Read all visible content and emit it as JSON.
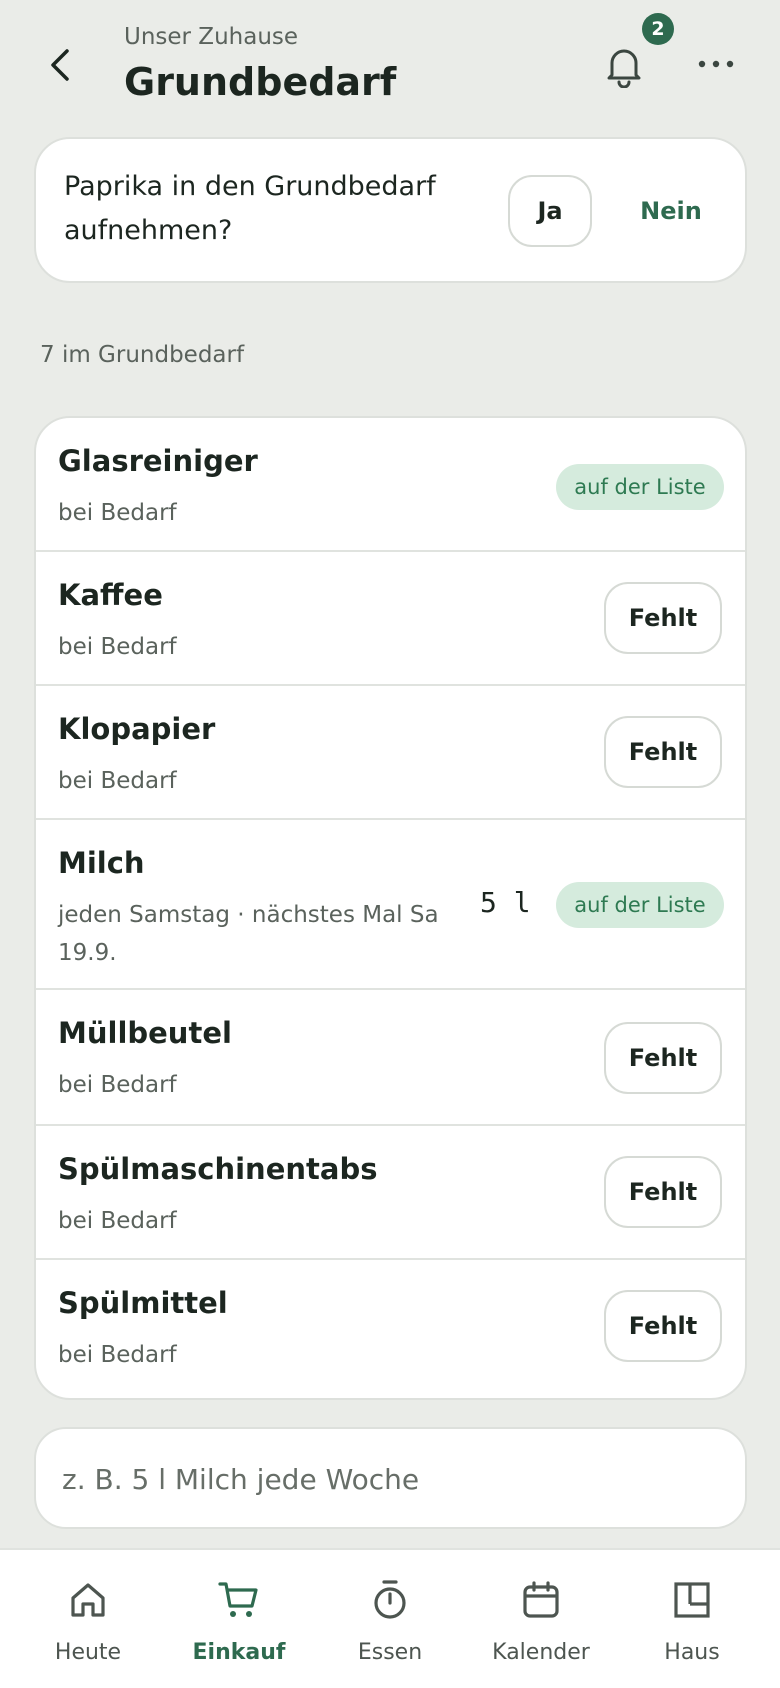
{
  "header": {
    "subtitle": "Unser Zuhause",
    "title": "Grundbedarf",
    "notification_count": "2",
    "back_icon": "chevron-left-icon",
    "bell_icon": "bell-icon",
    "more_icon": "more-horizontal-icon"
  },
  "suggestion": {
    "text": "Paprika in den Grundbedarf aufnehmen?",
    "yes_label": "Ja",
    "no_label": "Nein"
  },
  "list": {
    "count_label": "7 im Grundbedarf",
    "items": [
      {
        "name": "Glasreiniger",
        "detail": "bei Bedarf",
        "status": "auf der Liste"
      },
      {
        "name": "Kaffee",
        "detail": "bei Bedarf",
        "action": "Fehlt"
      },
      {
        "name": "Klopapier",
        "detail": "bei Bedarf",
        "action": "Fehlt"
      },
      {
        "name": "Milch",
        "detail": "jeden Samstag · nächstes Mal Sa 19.9.",
        "quantity": "5 l",
        "status": "auf der Liste"
      },
      {
        "name": "Müllbeutel",
        "detail": "bei Bedarf",
        "action": "Fehlt"
      },
      {
        "name": "Spülmaschinentabs",
        "detail": "bei Bedarf",
        "action": "Fehlt"
      },
      {
        "name": "Spülmittel",
        "detail": "bei Bedarf",
        "action": "Fehlt"
      }
    ]
  },
  "input": {
    "placeholder": "z. B. 5 l Milch jede Woche"
  },
  "nav": {
    "active": "Einkauf",
    "items": [
      {
        "label": "Heute",
        "icon": "home-icon"
      },
      {
        "label": "Einkauf",
        "icon": "cart-icon"
      },
      {
        "label": "Essen",
        "icon": "timer-icon"
      },
      {
        "label": "Kalender",
        "icon": "calendar-icon"
      },
      {
        "label": "Haus",
        "icon": "floorplan-icon"
      }
    ]
  },
  "colors": {
    "background": "#eaece8",
    "accent": "#2e6a4f",
    "pill_bg": "#d5ebdd",
    "pill_text": "#2e7a52"
  }
}
